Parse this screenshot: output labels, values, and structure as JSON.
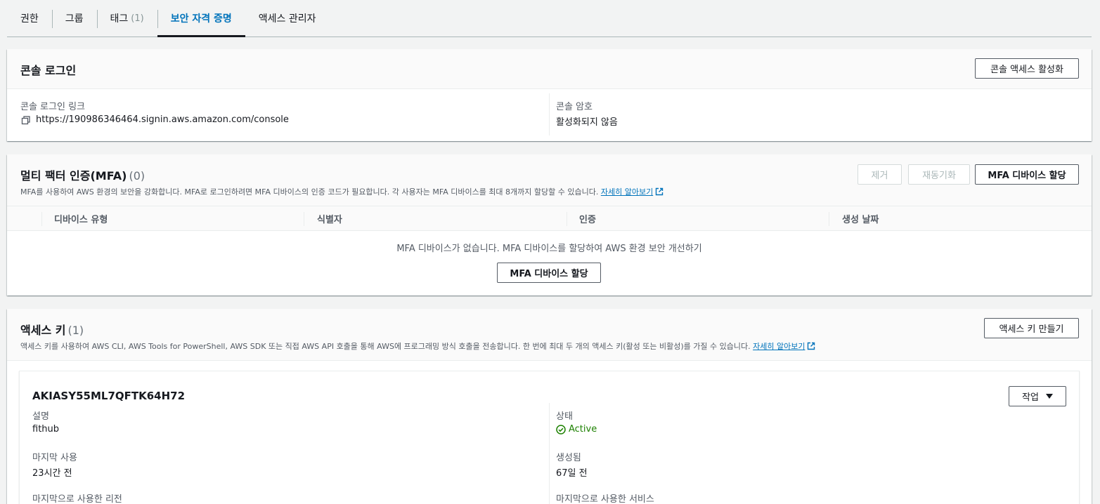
{
  "tabs": [
    {
      "label": "권한",
      "count": ""
    },
    {
      "label": "그룹",
      "count": ""
    },
    {
      "label": "태그",
      "count": "(1)"
    },
    {
      "label": "보안 자격 증명",
      "count": ""
    },
    {
      "label": "액세스 관리자",
      "count": ""
    }
  ],
  "active_tab": "보안 자격 증명",
  "console": {
    "title": "콘솔 로그인",
    "enable_button": "콘솔 액세스 활성화",
    "link_label": "콘솔 로그인 링크",
    "link_value": "https://190986346464.signin.aws.amazon.com/console",
    "password_label": "콘솔 암호",
    "password_value": "활성화되지 않음"
  },
  "mfa": {
    "title": "멀티 팩터 인증(MFA)",
    "count": "(0)",
    "description": "MFA를 사용하여 AWS 환경의 보안을 강화합니다. MFA로 로그인하려면 MFA 디바이스의 인증 코드가 필요합니다. 각 사용자는 MFA 디바이스를 최대 8개까지 할당할 수 있습니다.",
    "learn_more": "자세히 알아보기",
    "remove_button": "제거",
    "resync_button": "재동기화",
    "assign_button": "MFA 디바이스 할당",
    "columns": [
      "디바이스 유형",
      "식별자",
      "인증",
      "생성 날짜"
    ],
    "empty_message": "MFA 디바이스가 없습니다. MFA 디바이스를 할당하여 AWS 환경 보안 개선하기",
    "empty_button": "MFA 디바이스 할당"
  },
  "access_keys": {
    "title": "액세스 키",
    "count": "(1)",
    "description": "액세스 키를 사용하여 AWS CLI, AWS Tools for PowerShell, AWS SDK 또는 직접 AWS API 호출을 통해 AWS에 프로그래밍 방식 호출을 전송합니다. 한 번에 최대 두 개의 액세스 키(활성 또는 비활성)를 가질 수 있습니다.",
    "learn_more": "자세히 알아보기",
    "create_button": "액세스 키 만들기",
    "key": {
      "id": "AKIASY55ML7QFTK64H72",
      "actions_button": "작업",
      "description_label": "설명",
      "description_value": "fithub",
      "status_label": "상태",
      "status_value": "Active",
      "last_used_label": "마지막 사용",
      "last_used_value": "23시간 전",
      "created_label": "생성됨",
      "created_value": "67일 전",
      "last_region_label": "마지막으로 사용한 리전",
      "last_service_label": "마지막으로 사용한 서비스"
    }
  },
  "colors": {
    "link": "#0073bb",
    "active_status": "#1d8102",
    "background": "#f2f3f3"
  }
}
